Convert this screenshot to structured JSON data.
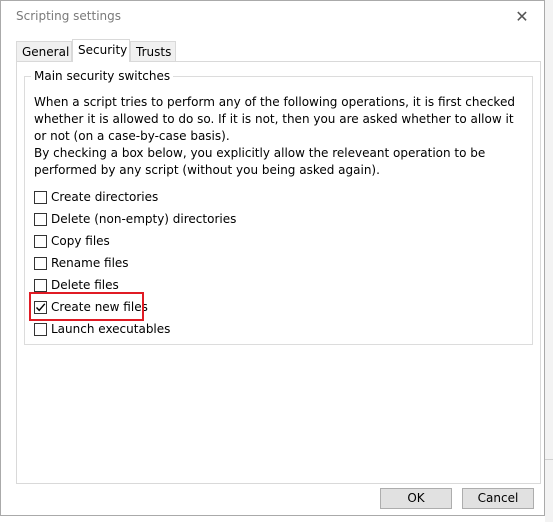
{
  "window": {
    "title": "Scripting settings",
    "close_symbol": "✕"
  },
  "tabs": [
    {
      "label": "General",
      "active": false
    },
    {
      "label": "Security",
      "active": true
    },
    {
      "label": "Trusts",
      "active": false
    }
  ],
  "security": {
    "group_title": "Main security switches",
    "description_1": "When a script tries to perform any of the following operations, it is first checked whether it is allowed to do so. If it is not, then you are asked whether to allow it or not (on a case-by-case basis).",
    "description_2": "By checking a box below, you explicitly allow the releveant operation to be performed by any script (without you being asked again).",
    "options": [
      {
        "label": "Create directories",
        "checked": false
      },
      {
        "label": "Delete (non-empty) directories",
        "checked": false
      },
      {
        "label": "Copy files",
        "checked": false
      },
      {
        "label": "Rename files",
        "checked": false
      },
      {
        "label": "Delete files",
        "checked": false
      },
      {
        "label": "Create new files",
        "checked": true
      },
      {
        "label": "Launch executables",
        "checked": false
      }
    ]
  },
  "buttons": {
    "ok_label": "OK",
    "cancel_label": "Cancel"
  },
  "colors": {
    "highlight": "#e01b24"
  }
}
